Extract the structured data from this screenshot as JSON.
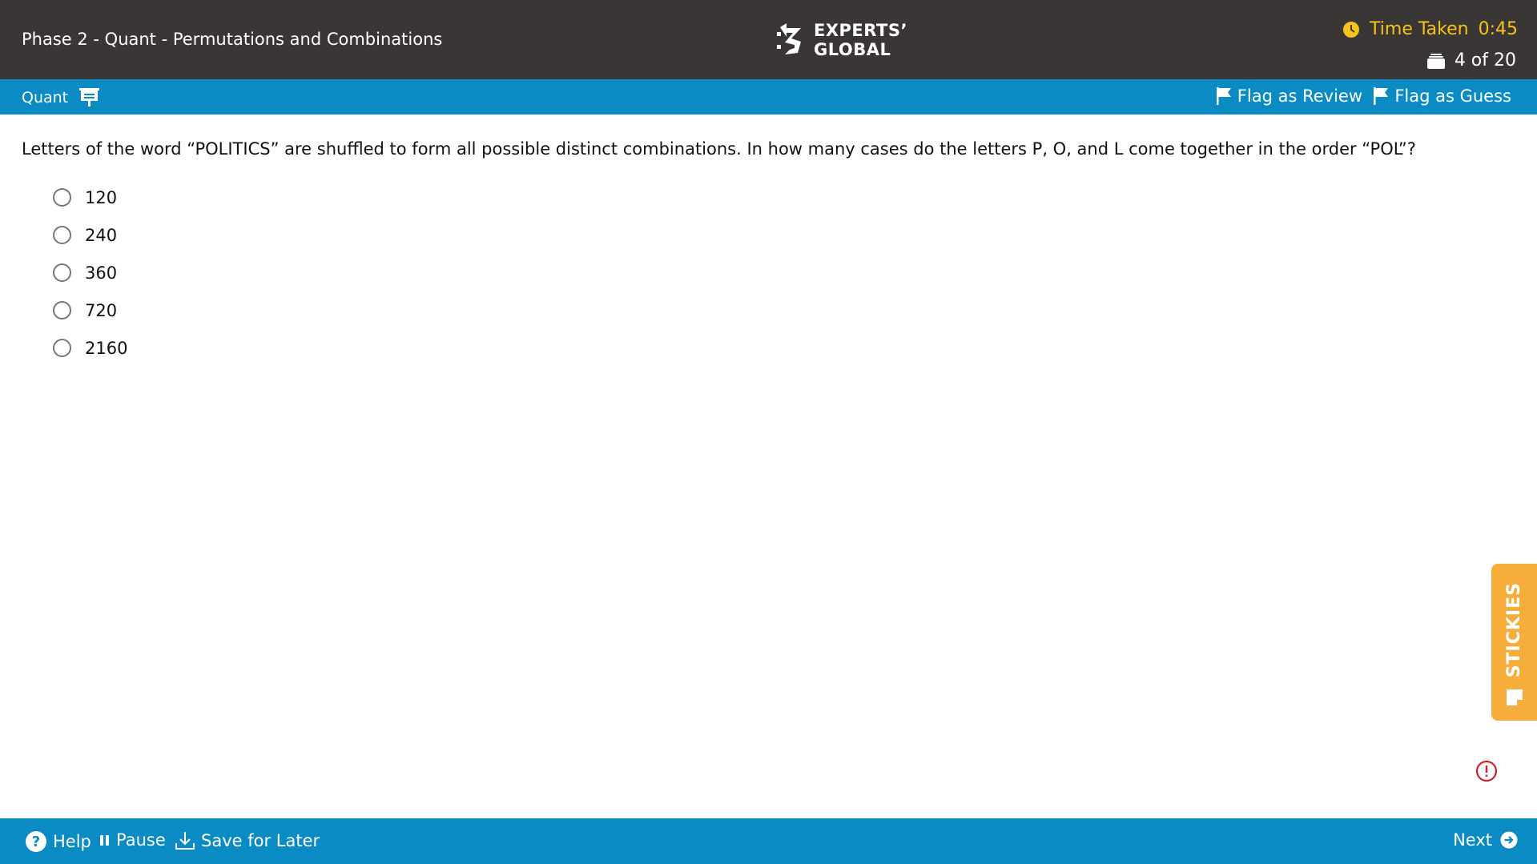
{
  "header": {
    "exam_title": "Phase 2 - Quant - Permutations and Combinations",
    "logo_line1": "EXPERTS’",
    "logo_line2": "GLOBAL",
    "time_label": "Time Taken",
    "time_value": "0:45",
    "progress": "4 of 20",
    "accent_color": "#f6c318"
  },
  "subbar": {
    "section": "Quant",
    "flag_review_label": "Flag as Review",
    "flag_guess_label": "Flag as Guess",
    "bar_color": "#0a8bc4"
  },
  "question": {
    "text": "Letters of the word “POLITICS” are shuffled to form all possible distinct combinations. In how many cases do the letters P, O, and L come together in the order “POL”?",
    "options": [
      "120",
      "240",
      "360",
      "720",
      "2160"
    ],
    "selected": null
  },
  "stickies": {
    "label": "STICKIES",
    "color": "#f6ad3b"
  },
  "footer": {
    "help_label": "Help",
    "pause_label": "Pause",
    "save_label": "Save for Later",
    "next_label": "Next"
  },
  "icons": [
    "clock-icon",
    "stack-icon",
    "whiteboard-icon",
    "flag-icon",
    "sticky-note-icon",
    "alert-icon",
    "help-icon",
    "pause-icon",
    "download-icon",
    "arrow-right-icon"
  ]
}
